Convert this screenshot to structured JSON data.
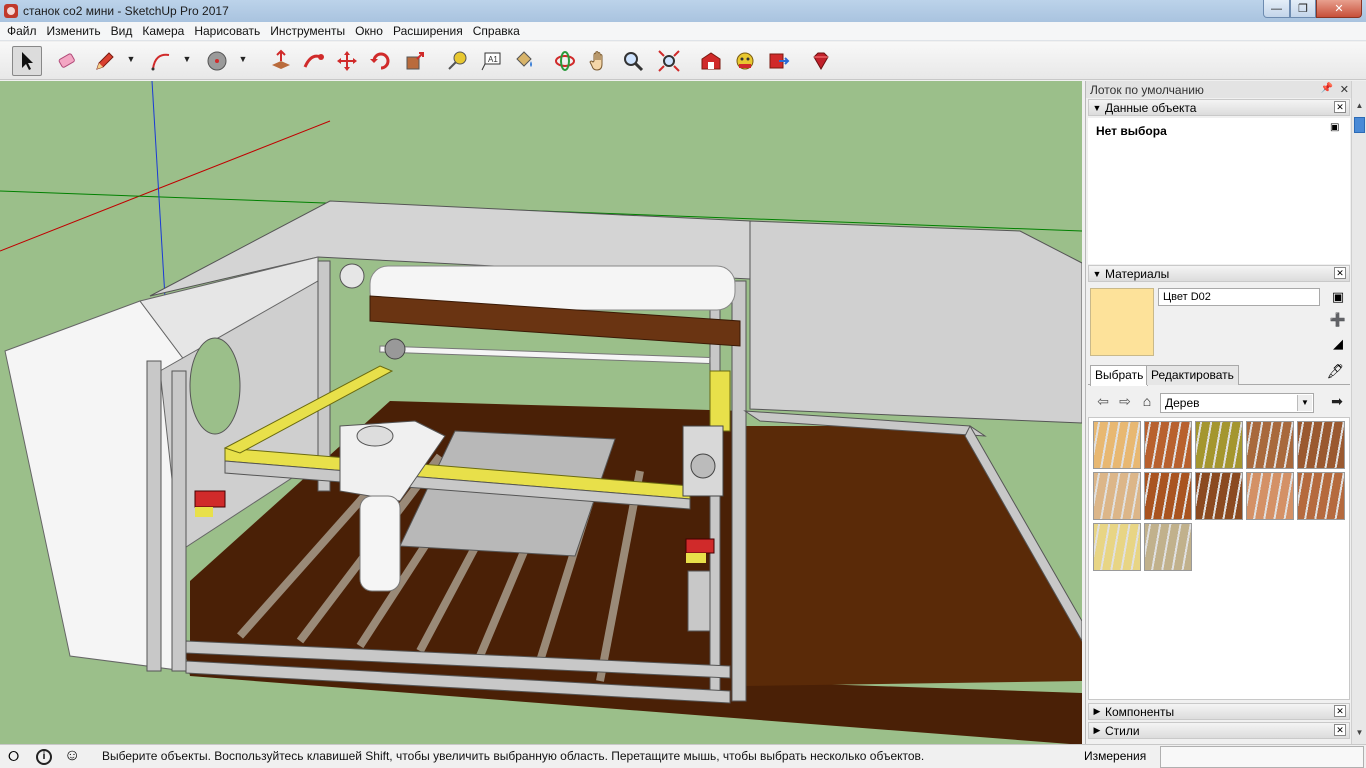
{
  "window": {
    "title": "станок со2 мини - SketchUp Pro 2017",
    "min_label": "—",
    "max_label": "❐",
    "close_label": "✕"
  },
  "menu": [
    "Файл",
    "Изменить",
    "Вид",
    "Камера",
    "Нарисовать",
    "Инструменты",
    "Окно",
    "Расширения",
    "Справка"
  ],
  "toolbar": {
    "tools": [
      "select-icon",
      "eraser-icon",
      "pencil-icon",
      "arc-icon",
      "shapes-icon",
      "push-pull-icon",
      "follow-me-icon",
      "move-icon",
      "rotate-icon",
      "scale-icon",
      "tape-measure-icon",
      "text-icon",
      "paint-bucket-icon",
      "orbit-icon",
      "pan-icon",
      "zoom-icon",
      "zoom-extents-icon",
      "warehouse-icon",
      "extension-warehouse-icon",
      "share-model-icon",
      "ruby-icon"
    ],
    "active_tool": "select-icon",
    "dropdown_arrow": "▼"
  },
  "tray": {
    "title": "Лоток по умолчанию",
    "entity_info": {
      "header": "Данные объекта",
      "selection": "Нет выбора"
    },
    "materials": {
      "header": "Материалы",
      "material_name": "Цвет D02",
      "swatch_color": "#fde29a",
      "tabs": [
        "Выбрать",
        "Редактировать"
      ],
      "active_tab": "Выбрать",
      "collection": "Дерев",
      "wood_swatches": [
        "#e8b872",
        "#b8612e",
        "#a4962f",
        "#a8693c",
        "#9a5930",
        "#dcb689",
        "#a95420",
        "#8b4a20",
        "#d49166",
        "#b56a3e",
        "#e8d585",
        "#c1b18c"
      ]
    },
    "components_header": "Компоненты",
    "styles_header": "Стили"
  },
  "status": {
    "hint": "Выберите объекты. Воспользуйтесь клавишей Shift, чтобы увеличить выбранную область. Перетащите мышь, чтобы выбрать несколько объектов.",
    "measurements_label": "Измерения",
    "measurements_value": "",
    "info_icon": "i"
  },
  "colors": {
    "sky": "#9bbf8a",
    "wood_dark": "#5a2a08",
    "rail_yellow": "#e8e04a",
    "frame_white": "#f5f5f5",
    "accent_blue": "#4a8ad6"
  }
}
